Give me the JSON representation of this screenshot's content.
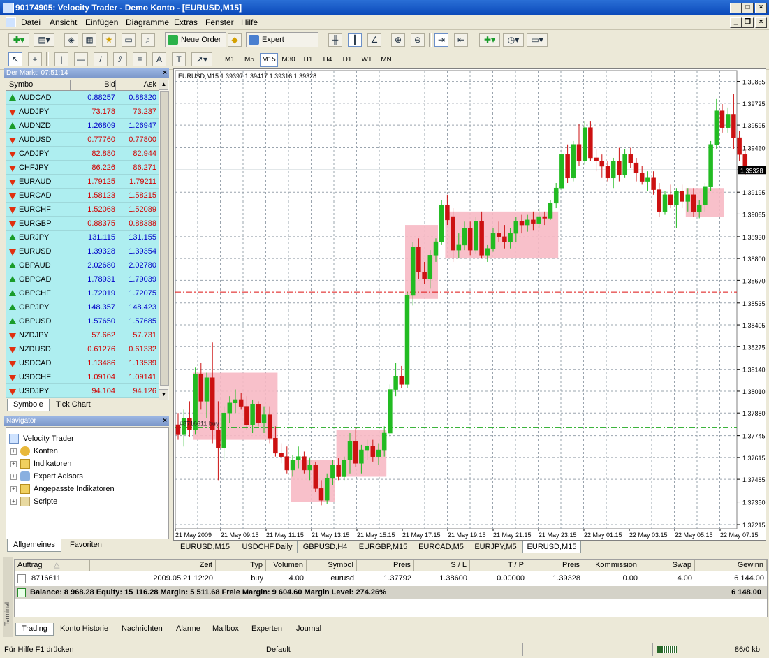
{
  "window": {
    "title": "90174905: Velocity Trader - Demo Konto - [EURUSD,M15]"
  },
  "menu": [
    "Datei",
    "Ansicht",
    "Einfügen",
    "Diagramme",
    "Extras",
    "Fenster",
    "Hilfe"
  ],
  "toolbar": {
    "new_order": "Neue Order",
    "expert_advisors": "Expert Advisors"
  },
  "timeframes": [
    "M1",
    "M5",
    "M15",
    "M30",
    "H1",
    "H4",
    "D1",
    "W1",
    "MN"
  ],
  "active_timeframe": "M15",
  "market_watch": {
    "title": "Der Markt: 07:51:14",
    "columns": [
      "Symbol",
      "Bid",
      "Ask"
    ],
    "rows": [
      {
        "symbol": "AUDCAD",
        "bid": "0.88257",
        "ask": "0.88320",
        "dir": "up",
        "color": "blue"
      },
      {
        "symbol": "AUDJPY",
        "bid": "73.178",
        "ask": "73.237",
        "dir": "down",
        "color": "red"
      },
      {
        "symbol": "AUDNZD",
        "bid": "1.26809",
        "ask": "1.26947",
        "dir": "up",
        "color": "blue"
      },
      {
        "symbol": "AUDUSD",
        "bid": "0.77760",
        "ask": "0.77800",
        "dir": "down",
        "color": "red"
      },
      {
        "symbol": "CADJPY",
        "bid": "82.880",
        "ask": "82.944",
        "dir": "down",
        "color": "red"
      },
      {
        "symbol": "CHFJPY",
        "bid": "86.226",
        "ask": "86.271",
        "dir": "down",
        "color": "red"
      },
      {
        "symbol": "EURAUD",
        "bid": "1.79125",
        "ask": "1.79211",
        "dir": "down",
        "color": "red"
      },
      {
        "symbol": "EURCAD",
        "bid": "1.58123",
        "ask": "1.58215",
        "dir": "down",
        "color": "red"
      },
      {
        "symbol": "EURCHF",
        "bid": "1.52068",
        "ask": "1.52089",
        "dir": "down",
        "color": "red"
      },
      {
        "symbol": "EURGBP",
        "bid": "0.88375",
        "ask": "0.88388",
        "dir": "down",
        "color": "red"
      },
      {
        "symbol": "EURJPY",
        "bid": "131.115",
        "ask": "131.155",
        "dir": "up",
        "color": "blue"
      },
      {
        "symbol": "EURUSD",
        "bid": "1.39328",
        "ask": "1.39354",
        "dir": "down",
        "color": "blue"
      },
      {
        "symbol": "GBPAUD",
        "bid": "2.02680",
        "ask": "2.02780",
        "dir": "up",
        "color": "blue"
      },
      {
        "symbol": "GBPCAD",
        "bid": "1.78931",
        "ask": "1.79039",
        "dir": "up",
        "color": "blue"
      },
      {
        "symbol": "GBPCHF",
        "bid": "1.72019",
        "ask": "1.72075",
        "dir": "up",
        "color": "blue"
      },
      {
        "symbol": "GBPJPY",
        "bid": "148.357",
        "ask": "148.423",
        "dir": "up",
        "color": "blue"
      },
      {
        "symbol": "GBPUSD",
        "bid": "1.57650",
        "ask": "1.57685",
        "dir": "up",
        "color": "blue"
      },
      {
        "symbol": "NZDJPY",
        "bid": "57.662",
        "ask": "57.731",
        "dir": "down",
        "color": "red"
      },
      {
        "symbol": "NZDUSD",
        "bid": "0.61276",
        "ask": "0.61332",
        "dir": "down",
        "color": "red"
      },
      {
        "symbol": "USDCAD",
        "bid": "1.13486",
        "ask": "1.13539",
        "dir": "down",
        "color": "red"
      },
      {
        "symbol": "USDCHF",
        "bid": "1.09104",
        "ask": "1.09141",
        "dir": "down",
        "color": "red"
      },
      {
        "symbol": "USDJPY",
        "bid": "94.104",
        "ask": "94.126",
        "dir": "down",
        "color": "red"
      }
    ],
    "tabs": [
      "Symbole",
      "Tick Chart"
    ]
  },
  "navigator": {
    "title": "Navigator",
    "root": "Velocity Trader",
    "items": [
      "Konten",
      "Indikatoren",
      "Expert Adisors",
      "Angepasste Indikatoren",
      "Scripte"
    ],
    "tabs": [
      "Allgemeines",
      "Favoriten"
    ]
  },
  "chart_data": {
    "type": "candlestick",
    "title": "EURUSD,M15  1.39397 1.39417 1.39316 1.39328",
    "current_price": "1.39328",
    "ylim": [
      1.3719,
      1.3992
    ],
    "y_ticks": [
      "1.39855",
      "1.39725",
      "1.39595",
      "1.39460",
      "1.39328",
      "1.39195",
      "1.39065",
      "1.38930",
      "1.38800",
      "1.38670",
      "1.38535",
      "1.38405",
      "1.38275",
      "1.38140",
      "1.38010",
      "1.37880",
      "1.37745",
      "1.37615",
      "1.37485",
      "1.37350",
      "1.37215"
    ],
    "x_ticks": [
      "21 May 2009",
      "21 May 09:15",
      "21 May 11:15",
      "21 May 13:15",
      "21 May 15:15",
      "21 May 17:15",
      "21 May 19:15",
      "21 May 21:15",
      "21 May 23:15",
      "22 May 01:15",
      "22 May 03:15",
      "22 May 05:15",
      "22 May 07:15"
    ],
    "order_label": "#8716611 buy",
    "levels": {
      "take_profit": 1.386,
      "open_price": 1.37792
    },
    "up_color": "#22bb22",
    "down_color": "#cc1111",
    "zone_color": "#f7b9c4",
    "zones": [
      {
        "from_bar": 3,
        "to_bar": 17,
        "high": 1.3812,
        "low": 1.3772
      },
      {
        "from_bar": 20,
        "to_bar": 27,
        "high": 1.376,
        "low": 1.3735
      },
      {
        "from_bar": 28,
        "to_bar": 36,
        "high": 1.3778,
        "low": 1.375
      },
      {
        "from_bar": 40,
        "to_bar": 45,
        "high": 1.39,
        "low": 1.3856
      },
      {
        "from_bar": 47,
        "to_bar": 66,
        "high": 1.3908,
        "low": 1.388
      },
      {
        "from_bar": 89,
        "to_bar": 95,
        "high": 1.3922,
        "low": 1.3905
      }
    ],
    "ohlc": [
      [
        1.3781,
        1.3788,
        1.3772,
        1.3775
      ],
      [
        1.3775,
        1.379,
        1.3768,
        1.3785
      ],
      [
        1.3785,
        1.3795,
        1.3774,
        1.3778
      ],
      [
        1.3778,
        1.3815,
        1.3775,
        1.3811
      ],
      [
        1.3811,
        1.3818,
        1.379,
        1.3795
      ],
      [
        1.3795,
        1.3812,
        1.3785,
        1.3809
      ],
      [
        1.3809,
        1.383,
        1.377,
        1.3778
      ],
      [
        1.3778,
        1.3795,
        1.3748,
        1.3767
      ],
      [
        1.3767,
        1.3792,
        1.376,
        1.3788
      ],
      [
        1.3788,
        1.3798,
        1.3782,
        1.3794
      ],
      [
        1.3794,
        1.3802,
        1.3788,
        1.3796
      ],
      [
        1.3796,
        1.38,
        1.379,
        1.3792
      ],
      [
        1.3792,
        1.3798,
        1.3778,
        1.3781
      ],
      [
        1.3781,
        1.3796,
        1.3776,
        1.3793
      ],
      [
        1.3793,
        1.3795,
        1.378,
        1.3782
      ],
      [
        1.3782,
        1.3792,
        1.3776,
        1.3787
      ],
      [
        1.3787,
        1.3792,
        1.377,
        1.3773
      ],
      [
        1.3773,
        1.378,
        1.3762,
        1.3764
      ],
      [
        1.3764,
        1.377,
        1.3758,
        1.3762
      ],
      [
        1.3762,
        1.3768,
        1.3752,
        1.3754
      ],
      [
        1.3754,
        1.3763,
        1.375,
        1.376
      ],
      [
        1.376,
        1.3768,
        1.3755,
        1.3762
      ],
      [
        1.3762,
        1.3765,
        1.3752,
        1.3754
      ],
      [
        1.3754,
        1.3761,
        1.3748,
        1.3757
      ],
      [
        1.3757,
        1.3759,
        1.3741,
        1.3743
      ],
      [
        1.3743,
        1.3748,
        1.3733,
        1.3736
      ],
      [
        1.3736,
        1.3752,
        1.3734,
        1.3749
      ],
      [
        1.3749,
        1.376,
        1.3745,
        1.3757
      ],
      [
        1.3757,
        1.3761,
        1.3748,
        1.375
      ],
      [
        1.375,
        1.3762,
        1.3748,
        1.376
      ],
      [
        1.376,
        1.3776,
        1.3752,
        1.3771
      ],
      [
        1.3771,
        1.3779,
        1.3756,
        1.3758
      ],
      [
        1.3758,
        1.3769,
        1.3752,
        1.3766
      ],
      [
        1.3766,
        1.3772,
        1.376,
        1.3768
      ],
      [
        1.3768,
        1.3772,
        1.3759,
        1.3762
      ],
      [
        1.3762,
        1.377,
        1.3757,
        1.3766
      ],
      [
        1.3766,
        1.378,
        1.3762,
        1.3776
      ],
      [
        1.3776,
        1.3805,
        1.3774,
        1.3802
      ],
      [
        1.3802,
        1.3818,
        1.3798,
        1.381
      ],
      [
        1.381,
        1.3816,
        1.3803,
        1.3805
      ],
      [
        1.3805,
        1.386,
        1.3803,
        1.3858
      ],
      [
        1.3858,
        1.389,
        1.3852,
        1.3887
      ],
      [
        1.3887,
        1.3892,
        1.3868,
        1.3872
      ],
      [
        1.3872,
        1.3878,
        1.3865,
        1.3868
      ],
      [
        1.3868,
        1.3885,
        1.3862,
        1.3882
      ],
      [
        1.3882,
        1.3892,
        1.3878,
        1.389
      ],
      [
        1.389,
        1.3915,
        1.3888,
        1.3912
      ],
      [
        1.3912,
        1.3918,
        1.39,
        1.3903
      ],
      [
        1.3905,
        1.391,
        1.3878,
        1.3885
      ],
      [
        1.3885,
        1.3895,
        1.388,
        1.3888
      ],
      [
        1.3888,
        1.3902,
        1.3885,
        1.3898
      ],
      [
        1.3898,
        1.3902,
        1.3882,
        1.3885
      ],
      [
        1.3885,
        1.3905,
        1.3883,
        1.3902
      ],
      [
        1.3902,
        1.3908,
        1.388,
        1.3882
      ],
      [
        1.3882,
        1.3888,
        1.3878,
        1.3886
      ],
      [
        1.3886,
        1.3898,
        1.3884,
        1.3895
      ],
      [
        1.3895,
        1.3902,
        1.389,
        1.3893
      ],
      [
        1.3893,
        1.39,
        1.3886,
        1.389
      ],
      [
        1.389,
        1.3898,
        1.3886,
        1.3895
      ],
      [
        1.3895,
        1.3905,
        1.389,
        1.3902
      ],
      [
        1.3902,
        1.3906,
        1.3895,
        1.39
      ],
      [
        1.39,
        1.3906,
        1.3896,
        1.3903
      ],
      [
        1.3903,
        1.3908,
        1.3897,
        1.3901
      ],
      [
        1.3901,
        1.391,
        1.3898,
        1.3905
      ],
      [
        1.3905,
        1.3908,
        1.39,
        1.3904
      ],
      [
        1.3904,
        1.3915,
        1.3903,
        1.3913
      ],
      [
        1.3913,
        1.3925,
        1.391,
        1.3922
      ],
      [
        1.3922,
        1.3945,
        1.392,
        1.3942
      ],
      [
        1.3942,
        1.3948,
        1.3925,
        1.3928
      ],
      [
        1.3928,
        1.395,
        1.3926,
        1.3948
      ],
      [
        1.3948,
        1.396,
        1.3935,
        1.3938
      ],
      [
        1.3938,
        1.3962,
        1.3936,
        1.3958
      ],
      [
        1.3958,
        1.3962,
        1.3938,
        1.394
      ],
      [
        1.394,
        1.3945,
        1.3932,
        1.3938
      ],
      [
        1.3938,
        1.3942,
        1.3928,
        1.3935
      ],
      [
        1.3935,
        1.3938,
        1.3926,
        1.3928
      ],
      [
        1.3928,
        1.394,
        1.3922,
        1.3938
      ],
      [
        1.3938,
        1.3946,
        1.3926,
        1.393
      ],
      [
        1.393,
        1.3945,
        1.3928,
        1.3942
      ],
      [
        1.3942,
        1.3946,
        1.3934,
        1.3937
      ],
      [
        1.3937,
        1.394,
        1.3926,
        1.3931
      ],
      [
        1.3931,
        1.3935,
        1.3924,
        1.3926
      ],
      [
        1.3926,
        1.3932,
        1.392,
        1.3928
      ],
      [
        1.3928,
        1.3932,
        1.3918,
        1.3921
      ],
      [
        1.3921,
        1.3925,
        1.3905,
        1.3908
      ],
      [
        1.3908,
        1.392,
        1.3906,
        1.3918
      ],
      [
        1.3918,
        1.3924,
        1.391,
        1.3912
      ],
      [
        1.3912,
        1.3922,
        1.3898,
        1.392
      ],
      [
        1.392,
        1.3924,
        1.391,
        1.3914
      ],
      [
        1.3914,
        1.3922,
        1.3908,
        1.3918
      ],
      [
        1.3918,
        1.3922,
        1.3905,
        1.3908
      ],
      [
        1.3908,
        1.3915,
        1.3904,
        1.3912
      ],
      [
        1.3912,
        1.3925,
        1.3908,
        1.3923
      ],
      [
        1.3923,
        1.395,
        1.392,
        1.3948
      ],
      [
        1.3948,
        1.3975,
        1.3945,
        1.3968
      ],
      [
        1.3968,
        1.3972,
        1.3955,
        1.3958
      ],
      [
        1.3958,
        1.397,
        1.3955,
        1.3966
      ],
      [
        1.3966,
        1.3978,
        1.3945,
        1.3952
      ],
      [
        1.3952,
        1.3956,
        1.3938,
        1.3942
      ],
      [
        1.3942,
        1.3945,
        1.393,
        1.3933
      ]
    ]
  },
  "chart_tabs": [
    "EURUSD,M15",
    "USDCHF,Daily",
    "GBPUSD,H4",
    "EURGBP,M15",
    "EURCAD,M5",
    "EURJPY,M5",
    "EURUSD,M15"
  ],
  "active_chart_tab": 6,
  "terminal": {
    "side_label": "Terminal",
    "columns": [
      "Auftrag",
      "Zeit",
      "Typ",
      "Volumen",
      "Symbol",
      "Preis",
      "S / L",
      "T / P",
      "Preis",
      "Kommission",
      "Swap",
      "Gewinn"
    ],
    "order": {
      "id": "8716611",
      "time": "2009.05.21 12:20",
      "type": "buy",
      "volume": "4.00",
      "symbol": "eurusd",
      "open_price": "1.37792",
      "sl": "1.38600",
      "tp": "0.00000",
      "price": "1.39328",
      "commission": "0.00",
      "swap": "4.00",
      "profit": "6 144.00"
    },
    "balance_line": "Balance: 8 968.28  Equity: 15 116.28  Margin: 5 511.68  Freie Margin: 9 604.60  Margin Level: 274.26%",
    "balance_total": "6 148.00",
    "tabs": [
      "Trading",
      "Konto Historie",
      "Nachrichten",
      "Alarme",
      "Mailbox",
      "Experten",
      "Journal"
    ]
  },
  "status": {
    "help": "Für Hilfe F1 drücken",
    "profile": "Default",
    "traffic": "86/0 kb"
  }
}
